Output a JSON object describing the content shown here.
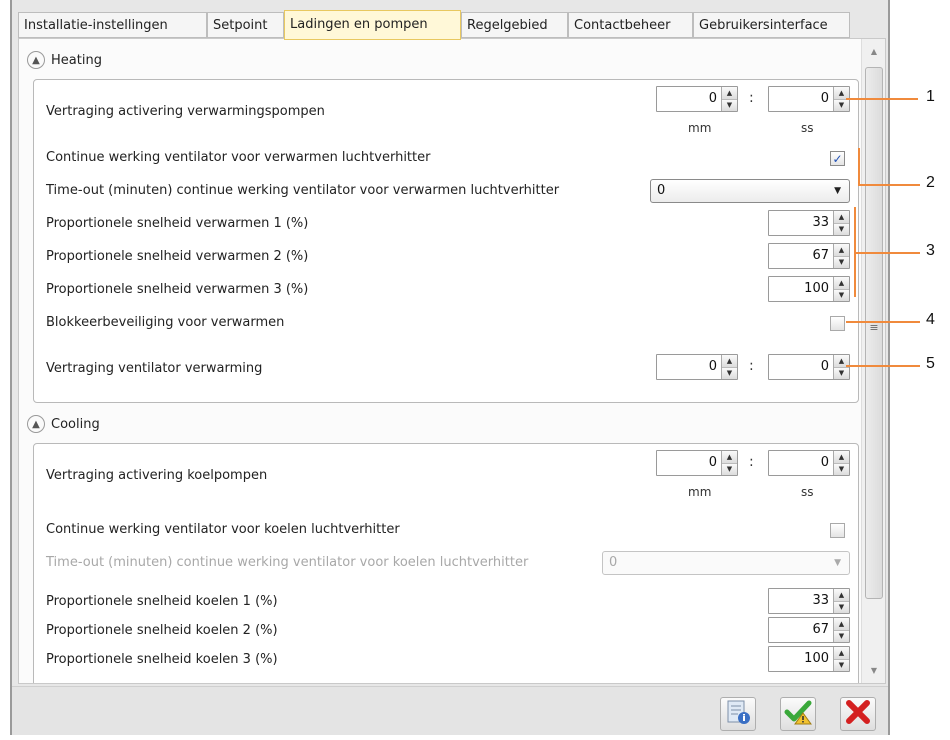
{
  "tabs": [
    {
      "label": "Installatie-instellingen"
    },
    {
      "label": "Setpoint"
    },
    {
      "label": "Ladingen en pompen"
    },
    {
      "label": "Regelgebied"
    },
    {
      "label": "Contactbeheer"
    },
    {
      "label": "Gebruikersinterface"
    }
  ],
  "active_tab": "Ladingen en pompen",
  "heating": {
    "title": "Heating",
    "pump_delay": {
      "label": "Vertraging activering verwarmingspompen",
      "mm": "0",
      "ss": "0"
    },
    "units": {
      "mm": "mm",
      "ss": "ss"
    },
    "fan_continuous": {
      "label": "Continue werking ventilator voor verwarmen luchtverhitter",
      "checked": true
    },
    "fan_timeout": {
      "label": "Time-out (minuten) continue werking ventilator voor verwarmen luchtverhitter",
      "value": "0"
    },
    "speed1": {
      "label": "Proportionele snelheid verwarmen 1 (%)",
      "value": "33"
    },
    "speed2": {
      "label": "Proportionele snelheid verwarmen 2 (%)",
      "value": "67"
    },
    "speed3": {
      "label": "Proportionele snelheid verwarmen 3 (%)",
      "value": "100"
    },
    "antiblock": {
      "label": "Blokkeerbeveiliging voor verwarmen",
      "checked": false
    },
    "fan_delay": {
      "label": "Vertraging ventilator verwarming",
      "mm": "0",
      "ss": "0"
    }
  },
  "cooling": {
    "title": "Cooling",
    "pump_delay": {
      "label": "Vertraging activering koelpompen",
      "mm": "0",
      "ss": "0"
    },
    "units": {
      "mm": "mm",
      "ss": "ss"
    },
    "fan_continuous": {
      "label": "Continue werking ventilator voor koelen luchtverhitter",
      "checked": false
    },
    "fan_timeout": {
      "label": "Time-out (minuten) continue werking ventilator voor koelen luchtverhitter",
      "value": "0"
    },
    "speed1": {
      "label": "Proportionele snelheid koelen 1 (%)",
      "value": "33"
    },
    "speed2": {
      "label": "Proportionele snelheid koelen 2 (%)",
      "value": "67"
    },
    "speed3": {
      "label": "Proportionele snelheid koelen 3 (%)",
      "value": "100"
    }
  },
  "callouts": [
    "1",
    "2",
    "3",
    "4",
    "5"
  ],
  "footer": {
    "info_icon": "info-document-icon",
    "apply_icon": "checkmark-warning-icon",
    "cancel_icon": "red-x-icon"
  },
  "colors": {
    "active_tab": "#fff8d8",
    "callout_line": "#f08a3c",
    "check": "#1f4fb5"
  }
}
